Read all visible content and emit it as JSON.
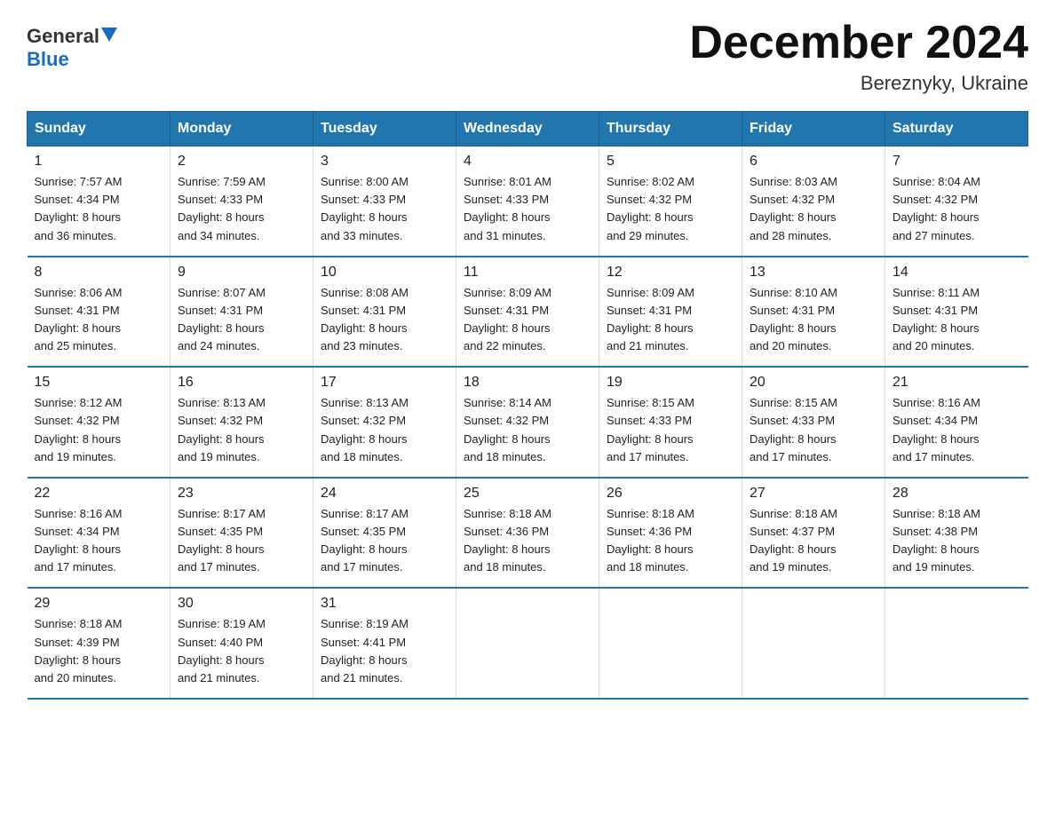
{
  "logo": {
    "general": "General",
    "triangle": "",
    "blue": "Blue"
  },
  "title": "December 2024",
  "subtitle": "Bereznyky, Ukraine",
  "days_of_week": [
    "Sunday",
    "Monday",
    "Tuesday",
    "Wednesday",
    "Thursday",
    "Friday",
    "Saturday"
  ],
  "weeks": [
    [
      {
        "day": "1",
        "sunrise": "7:57 AM",
        "sunset": "4:34 PM",
        "daylight": "8 hours and 36 minutes."
      },
      {
        "day": "2",
        "sunrise": "7:59 AM",
        "sunset": "4:33 PM",
        "daylight": "8 hours and 34 minutes."
      },
      {
        "day": "3",
        "sunrise": "8:00 AM",
        "sunset": "4:33 PM",
        "daylight": "8 hours and 33 minutes."
      },
      {
        "day": "4",
        "sunrise": "8:01 AM",
        "sunset": "4:33 PM",
        "daylight": "8 hours and 31 minutes."
      },
      {
        "day": "5",
        "sunrise": "8:02 AM",
        "sunset": "4:32 PM",
        "daylight": "8 hours and 29 minutes."
      },
      {
        "day": "6",
        "sunrise": "8:03 AM",
        "sunset": "4:32 PM",
        "daylight": "8 hours and 28 minutes."
      },
      {
        "day": "7",
        "sunrise": "8:04 AM",
        "sunset": "4:32 PM",
        "daylight": "8 hours and 27 minutes."
      }
    ],
    [
      {
        "day": "8",
        "sunrise": "8:06 AM",
        "sunset": "4:31 PM",
        "daylight": "8 hours and 25 minutes."
      },
      {
        "day": "9",
        "sunrise": "8:07 AM",
        "sunset": "4:31 PM",
        "daylight": "8 hours and 24 minutes."
      },
      {
        "day": "10",
        "sunrise": "8:08 AM",
        "sunset": "4:31 PM",
        "daylight": "8 hours and 23 minutes."
      },
      {
        "day": "11",
        "sunrise": "8:09 AM",
        "sunset": "4:31 PM",
        "daylight": "8 hours and 22 minutes."
      },
      {
        "day": "12",
        "sunrise": "8:09 AM",
        "sunset": "4:31 PM",
        "daylight": "8 hours and 21 minutes."
      },
      {
        "day": "13",
        "sunrise": "8:10 AM",
        "sunset": "4:31 PM",
        "daylight": "8 hours and 20 minutes."
      },
      {
        "day": "14",
        "sunrise": "8:11 AM",
        "sunset": "4:31 PM",
        "daylight": "8 hours and 20 minutes."
      }
    ],
    [
      {
        "day": "15",
        "sunrise": "8:12 AM",
        "sunset": "4:32 PM",
        "daylight": "8 hours and 19 minutes."
      },
      {
        "day": "16",
        "sunrise": "8:13 AM",
        "sunset": "4:32 PM",
        "daylight": "8 hours and 19 minutes."
      },
      {
        "day": "17",
        "sunrise": "8:13 AM",
        "sunset": "4:32 PM",
        "daylight": "8 hours and 18 minutes."
      },
      {
        "day": "18",
        "sunrise": "8:14 AM",
        "sunset": "4:32 PM",
        "daylight": "8 hours and 18 minutes."
      },
      {
        "day": "19",
        "sunrise": "8:15 AM",
        "sunset": "4:33 PM",
        "daylight": "8 hours and 17 minutes."
      },
      {
        "day": "20",
        "sunrise": "8:15 AM",
        "sunset": "4:33 PM",
        "daylight": "8 hours and 17 minutes."
      },
      {
        "day": "21",
        "sunrise": "8:16 AM",
        "sunset": "4:34 PM",
        "daylight": "8 hours and 17 minutes."
      }
    ],
    [
      {
        "day": "22",
        "sunrise": "8:16 AM",
        "sunset": "4:34 PM",
        "daylight": "8 hours and 17 minutes."
      },
      {
        "day": "23",
        "sunrise": "8:17 AM",
        "sunset": "4:35 PM",
        "daylight": "8 hours and 17 minutes."
      },
      {
        "day": "24",
        "sunrise": "8:17 AM",
        "sunset": "4:35 PM",
        "daylight": "8 hours and 17 minutes."
      },
      {
        "day": "25",
        "sunrise": "8:18 AM",
        "sunset": "4:36 PM",
        "daylight": "8 hours and 18 minutes."
      },
      {
        "day": "26",
        "sunrise": "8:18 AM",
        "sunset": "4:36 PM",
        "daylight": "8 hours and 18 minutes."
      },
      {
        "day": "27",
        "sunrise": "8:18 AM",
        "sunset": "4:37 PM",
        "daylight": "8 hours and 19 minutes."
      },
      {
        "day": "28",
        "sunrise": "8:18 AM",
        "sunset": "4:38 PM",
        "daylight": "8 hours and 19 minutes."
      }
    ],
    [
      {
        "day": "29",
        "sunrise": "8:18 AM",
        "sunset": "4:39 PM",
        "daylight": "8 hours and 20 minutes."
      },
      {
        "day": "30",
        "sunrise": "8:19 AM",
        "sunset": "4:40 PM",
        "daylight": "8 hours and 21 minutes."
      },
      {
        "day": "31",
        "sunrise": "8:19 AM",
        "sunset": "4:41 PM",
        "daylight": "8 hours and 21 minutes."
      },
      null,
      null,
      null,
      null
    ]
  ],
  "labels": {
    "sunrise": "Sunrise:",
    "sunset": "Sunset:",
    "daylight": "Daylight:"
  }
}
